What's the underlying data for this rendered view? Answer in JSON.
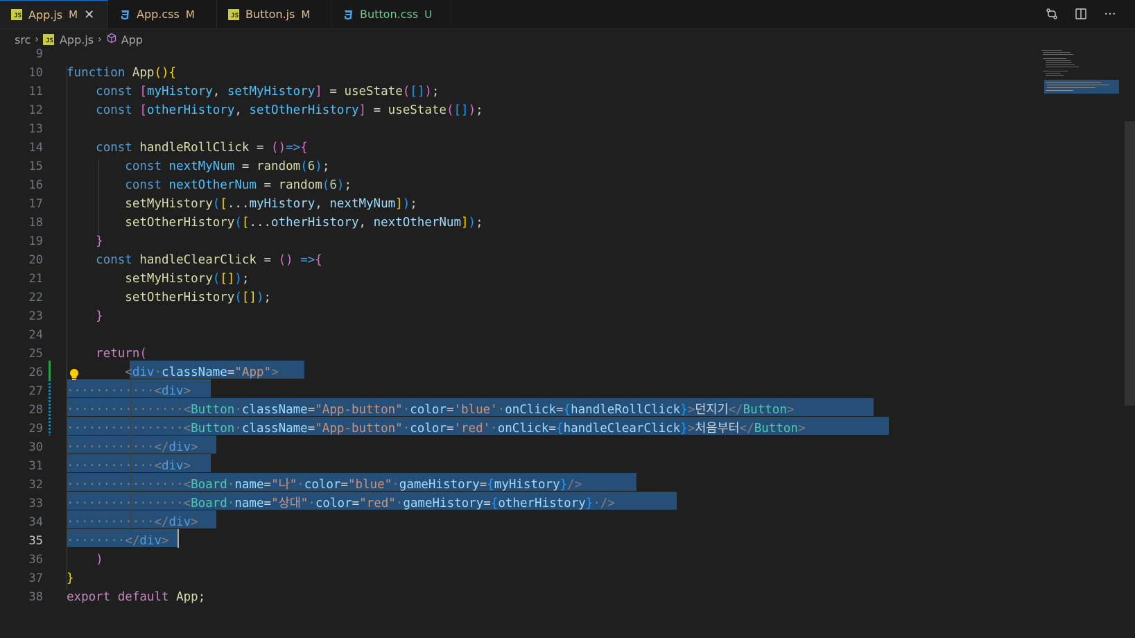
{
  "tabs": [
    {
      "name": "App.js",
      "icon": "js-file-icon",
      "status": "M",
      "active": true
    },
    {
      "name": "App.css",
      "icon": "css-file-icon",
      "status": "M",
      "active": false
    },
    {
      "name": "Button.js",
      "icon": "js-file-icon",
      "status": "M",
      "active": false
    },
    {
      "name": "Button.css",
      "icon": "css-file-icon",
      "status": "U",
      "active": false
    }
  ],
  "js_badge": "JS",
  "breadcrumb": {
    "folder": "src",
    "file": "App.js",
    "symbol": "App"
  },
  "lines": [
    {
      "n": "9",
      "html": ""
    },
    {
      "n": "10",
      "html": "<span class='k'>function</span> <span class='f'>App</span><span class='b1'>()</span><span class='b1'>{</span>"
    },
    {
      "n": "11",
      "html": "    <span class='k'>const</span> <span class='b2'>[</span><span class='n'>myHistory</span><span class='w'>, </span><span class='n'>setMyHistory</span><span class='b2'>]</span><span class='w'> = </span><span class='f'>useState</span><span class='b2'>(</span><span class='b3'>[]</span><span class='b2'>)</span><span class='w'>;</span>"
    },
    {
      "n": "12",
      "html": "    <span class='k'>const</span> <span class='b2'>[</span><span class='n'>otherHistory</span><span class='w'>, </span><span class='n'>setOtherHistory</span><span class='b2'>]</span><span class='w'> = </span><span class='f'>useState</span><span class='b2'>(</span><span class='b3'>[]</span><span class='b2'>)</span><span class='w'>;</span>"
    },
    {
      "n": "13",
      "html": ""
    },
    {
      "n": "14",
      "html": "    <span class='k'>const</span> <span class='f'>handleRollClick</span><span class='w'> = </span><span class='b2'>()</span><span class='k'>=&gt;</span><span class='b2'>{</span>"
    },
    {
      "n": "15",
      "html": "        <span class='k'>const</span> <span class='n'>nextMyNum</span><span class='w'> = </span><span class='f'>random</span><span class='b3'>(</span><span class='num'>6</span><span class='b3'>)</span><span class='w'>;</span>"
    },
    {
      "n": "16",
      "html": "        <span class='k'>const</span> <span class='n'>nextOtherNum</span><span class='w'> = </span><span class='f'>random</span><span class='b3'>(</span><span class='num'>6</span><span class='b3'>)</span><span class='w'>;</span>"
    },
    {
      "n": "17",
      "html": "        <span class='f'>setMyHistory</span><span class='b3'>(</span><span class='b1'>[</span><span class='w'>...</span><span class='v'>myHistory</span><span class='w'>, </span><span class='v'>nextMyNum</span><span class='b1'>]</span><span class='b3'>)</span><span class='w'>;</span>"
    },
    {
      "n": "18",
      "html": "        <span class='f'>setOtherHistory</span><span class='b3'>(</span><span class='b1'>[</span><span class='w'>...</span><span class='v'>otherHistory</span><span class='w'>, </span><span class='v'>nextOtherNum</span><span class='b1'>]</span><span class='b3'>)</span><span class='w'>;</span>"
    },
    {
      "n": "19",
      "html": "    <span class='b2'>}</span>"
    },
    {
      "n": "20",
      "html": "    <span class='k'>const</span> <span class='f'>handleClearClick</span><span class='w'> = </span><span class='b2'>()</span> <span class='k'>=&gt;</span><span class='b2'>{</span>"
    },
    {
      "n": "21",
      "html": "        <span class='f'>setMyHistory</span><span class='b3'>(</span><span class='b1'>[]</span><span class='b3'>)</span><span class='w'>;</span>"
    },
    {
      "n": "22",
      "html": "        <span class='f'>setOtherHistory</span><span class='b3'>(</span><span class='b1'>[]</span><span class='b3'>)</span><span class='w'>;</span>"
    },
    {
      "n": "23",
      "html": "    <span class='b2'>}</span>"
    },
    {
      "n": "24",
      "html": ""
    },
    {
      "n": "25",
      "html": "    <span class='c'>return</span><span class='b2'>(</span>"
    },
    {
      "n": "26",
      "html": "        <span class='p'>&lt;</span><span class='tg'>div</span><span class='dim'>·</span><span class='v'>className</span><span class='w'>=</span><span class='s'>\"App\"</span><span class='p'>&gt;</span>"
    },
    {
      "n": "27",
      "html": "<span class='dim'>············</span><span class='p'>&lt;</span><span class='tg'>div</span><span class='p'>&gt;</span>"
    },
    {
      "n": "28",
      "html": "<span class='dim'>················</span><span class='p'>&lt;</span><span class='t'>Button</span><span class='dim'>·</span><span class='v'>className</span><span class='w'>=</span><span class='s'>\"App-button\"</span><span class='dim'>·</span><span class='v'>color</span><span class='w'>=</span><span class='s'>'blue'</span><span class='dim'>·</span><span class='v'>onClick</span><span class='w'>=</span><span class='b3'>{</span><span class='v'>handleRollClick</span><span class='b3'>}</span><span class='p'>&gt;</span><span class='w'>던지기</span><span class='p'>&lt;/</span><span class='t'>Button</span><span class='p'>&gt;</span>"
    },
    {
      "n": "29",
      "html": "<span class='dim'>················</span><span class='p'>&lt;</span><span class='t'>Button</span><span class='dim'>·</span><span class='v'>className</span><span class='w'>=</span><span class='s'>\"App-button\"</span><span class='dim'>·</span><span class='v'>color</span><span class='w'>=</span><span class='s'>'red'</span><span class='dim'>·</span><span class='v'>onClick</span><span class='w'>=</span><span class='b3'>{</span><span class='v'>handleClearClick</span><span class='b3'>}</span><span class='p'>&gt;</span><span class='w'>처음부터</span><span class='p'>&lt;/</span><span class='t'>Button</span><span class='p'>&gt;</span>"
    },
    {
      "n": "30",
      "html": "<span class='dim'>············</span><span class='p'>&lt;/</span><span class='tg'>div</span><span class='p'>&gt;</span>"
    },
    {
      "n": "31",
      "html": "<span class='dim'>············</span><span class='p'>&lt;</span><span class='tg'>div</span><span class='p'>&gt;</span>"
    },
    {
      "n": "32",
      "html": "<span class='dim'>················</span><span class='p'>&lt;</span><span class='t'>Board</span><span class='dim'>·</span><span class='v'>name</span><span class='w'>=</span><span class='s'>\"나\"</span><span class='dim'>·</span><span class='v'>color</span><span class='w'>=</span><span class='s'>\"blue\"</span><span class='dim'>·</span><span class='v'>gameHistory</span><span class='w'>=</span><span class='b3'>{</span><span class='v'>myHistory</span><span class='b3'>}</span><span class='p'>/&gt;</span>"
    },
    {
      "n": "33",
      "html": "<span class='dim'>················</span><span class='p'>&lt;</span><span class='t'>Board</span><span class='dim'>·</span><span class='v'>name</span><span class='w'>=</span><span class='s'>\"상대\"</span><span class='dim'>·</span><span class='v'>color</span><span class='w'>=</span><span class='s'>\"red\"</span><span class='dim'>·</span><span class='v'>gameHistory</span><span class='w'>=</span><span class='b3'>{</span><span class='v'>otherHistory</span><span class='b3'>}</span><span class='dim'>·</span><span class='p'>/&gt;</span>"
    },
    {
      "n": "34",
      "html": "<span class='dim'>············</span><span class='p'>&lt;/</span><span class='tg'>div</span><span class='p'>&gt;</span>"
    },
    {
      "n": "35",
      "html": "<span class='dim'>········</span><span class='p'>&lt;/</span><span class='tg'>div</span><span class='p'>&gt;</span>"
    },
    {
      "n": "36",
      "html": "    <span class='b2'>)</span>"
    },
    {
      "n": "37",
      "html": "<span class='b1'>}</span>"
    },
    {
      "n": "38",
      "html": "<span class='c'>export</span> <span class='c'>default</span> <span class='f'>App</span><span class='w'>;</span>"
    }
  ]
}
